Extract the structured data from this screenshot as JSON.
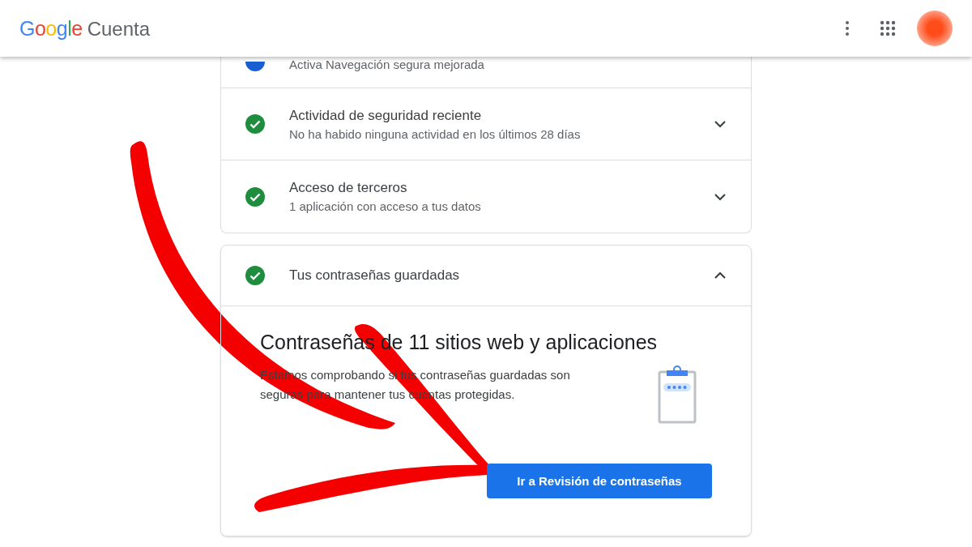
{
  "header": {
    "logo": "Google",
    "product": "Cuenta"
  },
  "security_rows": [
    {
      "kind": "info",
      "subtitle": "Activa Navegación segura mejorada"
    },
    {
      "kind": "ok",
      "title": "Actividad de seguridad reciente",
      "subtitle": "No ha habido ninguna actividad en los últimos 28 días",
      "expanded": false
    },
    {
      "kind": "ok",
      "title": "Acceso de terceros",
      "subtitle": "1 aplicación con acceso a tus datos",
      "expanded": false
    }
  ],
  "passwords": {
    "kind": "ok",
    "title": "Tus contraseñas guardadas",
    "expanded": true,
    "heading": "Contraseñas de 11 sitios web y aplicaciones",
    "body": "Estamos comprobando si tus contraseñas guardadas son seguras para mantener tus cuentas protegidas.",
    "button": "Ir a Revisión de contraseñas"
  }
}
